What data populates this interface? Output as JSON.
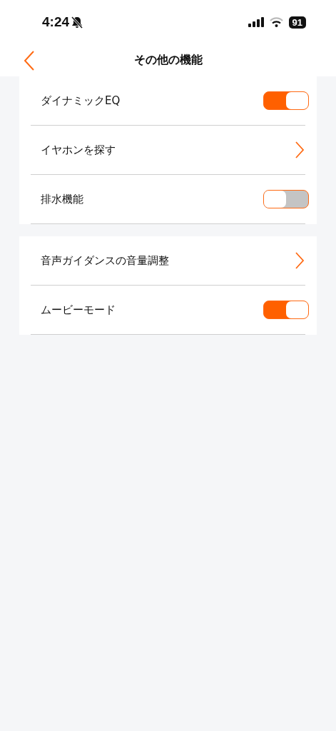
{
  "status_bar": {
    "time": "4:24",
    "silent": true,
    "battery": "91"
  },
  "nav": {
    "title": "その他の機能"
  },
  "sections": [
    {
      "items": [
        {
          "kind": "toggle",
          "label": "ダイナミックEQ",
          "on": true
        },
        {
          "kind": "link",
          "label": "イヤホンを探す"
        },
        {
          "kind": "toggle",
          "label": "排水機能",
          "on": false
        }
      ]
    },
    {
      "items": [
        {
          "kind": "link",
          "label": "音声ガイダンスの音量調整"
        },
        {
          "kind": "toggle",
          "label": "ムービーモード",
          "on": true
        }
      ]
    }
  ]
}
